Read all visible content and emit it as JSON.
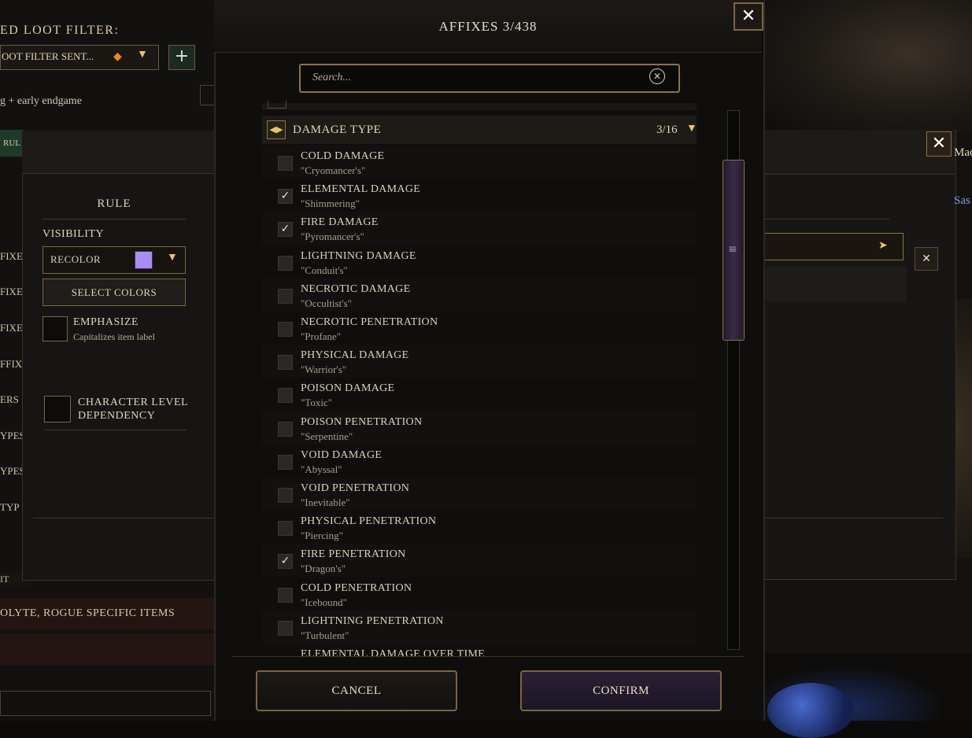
{
  "background": {
    "loot_filter": {
      "title": "ED LOOT FILTER:",
      "selected_filter": "OOT FILTER SENT...",
      "description": "g + early endgame",
      "rule_tab_partial": "RUL",
      "side_labels": [
        "FIXE",
        "FIXE",
        "FIXE",
        "FFIX",
        "ERS",
        "YPES",
        "YPES",
        "TYP"
      ],
      "bottom_label": "OLYTE, ROGUE SPECIFIC ITEMS",
      "item_partial": "IT"
    },
    "rule_window": {
      "title": "RULE",
      "visibility_label": "VISIBILITY",
      "visibility_value": "RECOLOR",
      "swatch_color": "#a98ef2",
      "select_colors_label": "SELECT COLORS",
      "emphasize_label": "EMPHASIZE",
      "emphasize_sub": "Capitalizes item label",
      "character_level_label_1": "CHARACTER LEVEL",
      "character_level_label_2": "DEPENDENCY"
    },
    "right_window": {
      "partial_text_1": "Mac",
      "partial_text_2": "Sas"
    }
  },
  "modal": {
    "title": "AFFIXES 3/438",
    "search": {
      "placeholder": "Search..."
    },
    "category": {
      "label": "DAMAGE TYPE",
      "count": "3/16"
    },
    "items": [
      {
        "name": "COLD DAMAGE",
        "sub": "\"Cryomancer's\"",
        "checked": false
      },
      {
        "name": "ELEMENTAL DAMAGE",
        "sub": "\"Shimmering\"",
        "checked": true
      },
      {
        "name": "FIRE DAMAGE",
        "sub": "\"Pyromancer's\"",
        "checked": true
      },
      {
        "name": "LIGHTNING DAMAGE",
        "sub": "\"Conduit's\"",
        "checked": false
      },
      {
        "name": "NECROTIC DAMAGE",
        "sub": "\"Occultist's\"",
        "checked": false
      },
      {
        "name": "NECROTIC PENETRATION",
        "sub": "\"Profane\"",
        "checked": false
      },
      {
        "name": "PHYSICAL DAMAGE",
        "sub": "\"Warrior's\"",
        "checked": false
      },
      {
        "name": "POISON DAMAGE",
        "sub": "\"Toxic\"",
        "checked": false
      },
      {
        "name": "POISON PENETRATION",
        "sub": "\"Serpentine\"",
        "checked": false
      },
      {
        "name": "VOID DAMAGE",
        "sub": "\"Abyssal\"",
        "checked": false
      },
      {
        "name": "VOID PENETRATION",
        "sub": "\"Inevitable\"",
        "checked": false
      },
      {
        "name": "PHYSICAL PENETRATION",
        "sub": "\"Piercing\"",
        "checked": false
      },
      {
        "name": "FIRE PENETRATION",
        "sub": "\"Dragon's\"",
        "checked": true
      },
      {
        "name": "COLD PENETRATION",
        "sub": "\"Icebound\"",
        "checked": false
      },
      {
        "name": "LIGHTNING PENETRATION",
        "sub": "\"Turbulent\"",
        "checked": false
      }
    ],
    "partial_item": "ELEMENTAL DAMAGE OVER TIME",
    "cancel_label": "CANCEL",
    "confirm_label": "CONFIRM",
    "check_glyph": "✓",
    "close_glyph": "✕"
  },
  "icons": {
    "close": "close-icon",
    "dropdown": "chevron-down-icon",
    "add": "plus-icon",
    "fox": "fox-icon",
    "clear": "clear-search-icon",
    "collapse": "collapse-icon"
  }
}
